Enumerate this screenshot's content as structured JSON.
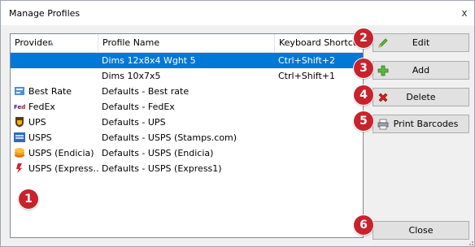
{
  "window": {
    "title": "Manage Profiles",
    "close_glyph": "x"
  },
  "list": {
    "columns": [
      "Provider",
      "Profile Name",
      "Keyboard Shortcut"
    ],
    "rows": [
      {
        "provider": "",
        "name": "Dims 12x8x4 Wght 5",
        "shortcut": "Ctrl+Shift+2",
        "selected": true,
        "icon": ""
      },
      {
        "provider": "",
        "name": "Dims 10x7x5",
        "shortcut": "Ctrl+Shift+1",
        "selected": false,
        "icon": ""
      },
      {
        "provider": "Best Rate",
        "name": "Defaults - Best rate",
        "shortcut": "",
        "selected": false,
        "icon": "best-rate-icon"
      },
      {
        "provider": "FedEx",
        "name": "Defaults - FedEx",
        "shortcut": "",
        "selected": false,
        "icon": "fedex-icon"
      },
      {
        "provider": "UPS",
        "name": "Defaults - UPS",
        "shortcut": "",
        "selected": false,
        "icon": "ups-icon"
      },
      {
        "provider": "USPS",
        "name": "Defaults - USPS (Stamps.com)",
        "shortcut": "",
        "selected": false,
        "icon": "usps-icon"
      },
      {
        "provider": "USPS (Endicia)",
        "name": "Defaults - USPS (Endicia)",
        "shortcut": "",
        "selected": false,
        "icon": "usps-endicia-icon"
      },
      {
        "provider": "USPS (Express…",
        "name": "Defaults - USPS (Express1)",
        "shortcut": "",
        "selected": false,
        "icon": "usps-express1-icon"
      }
    ]
  },
  "buttons": {
    "edit": "Edit",
    "add": "Add",
    "delete": "Delete",
    "print_barcodes": "Print Barcodes",
    "close": "Close"
  },
  "badges": [
    "1",
    "2",
    "3",
    "4",
    "5",
    "6"
  ],
  "colors": {
    "selection": "#0078d7",
    "badge": "#c8232c"
  }
}
